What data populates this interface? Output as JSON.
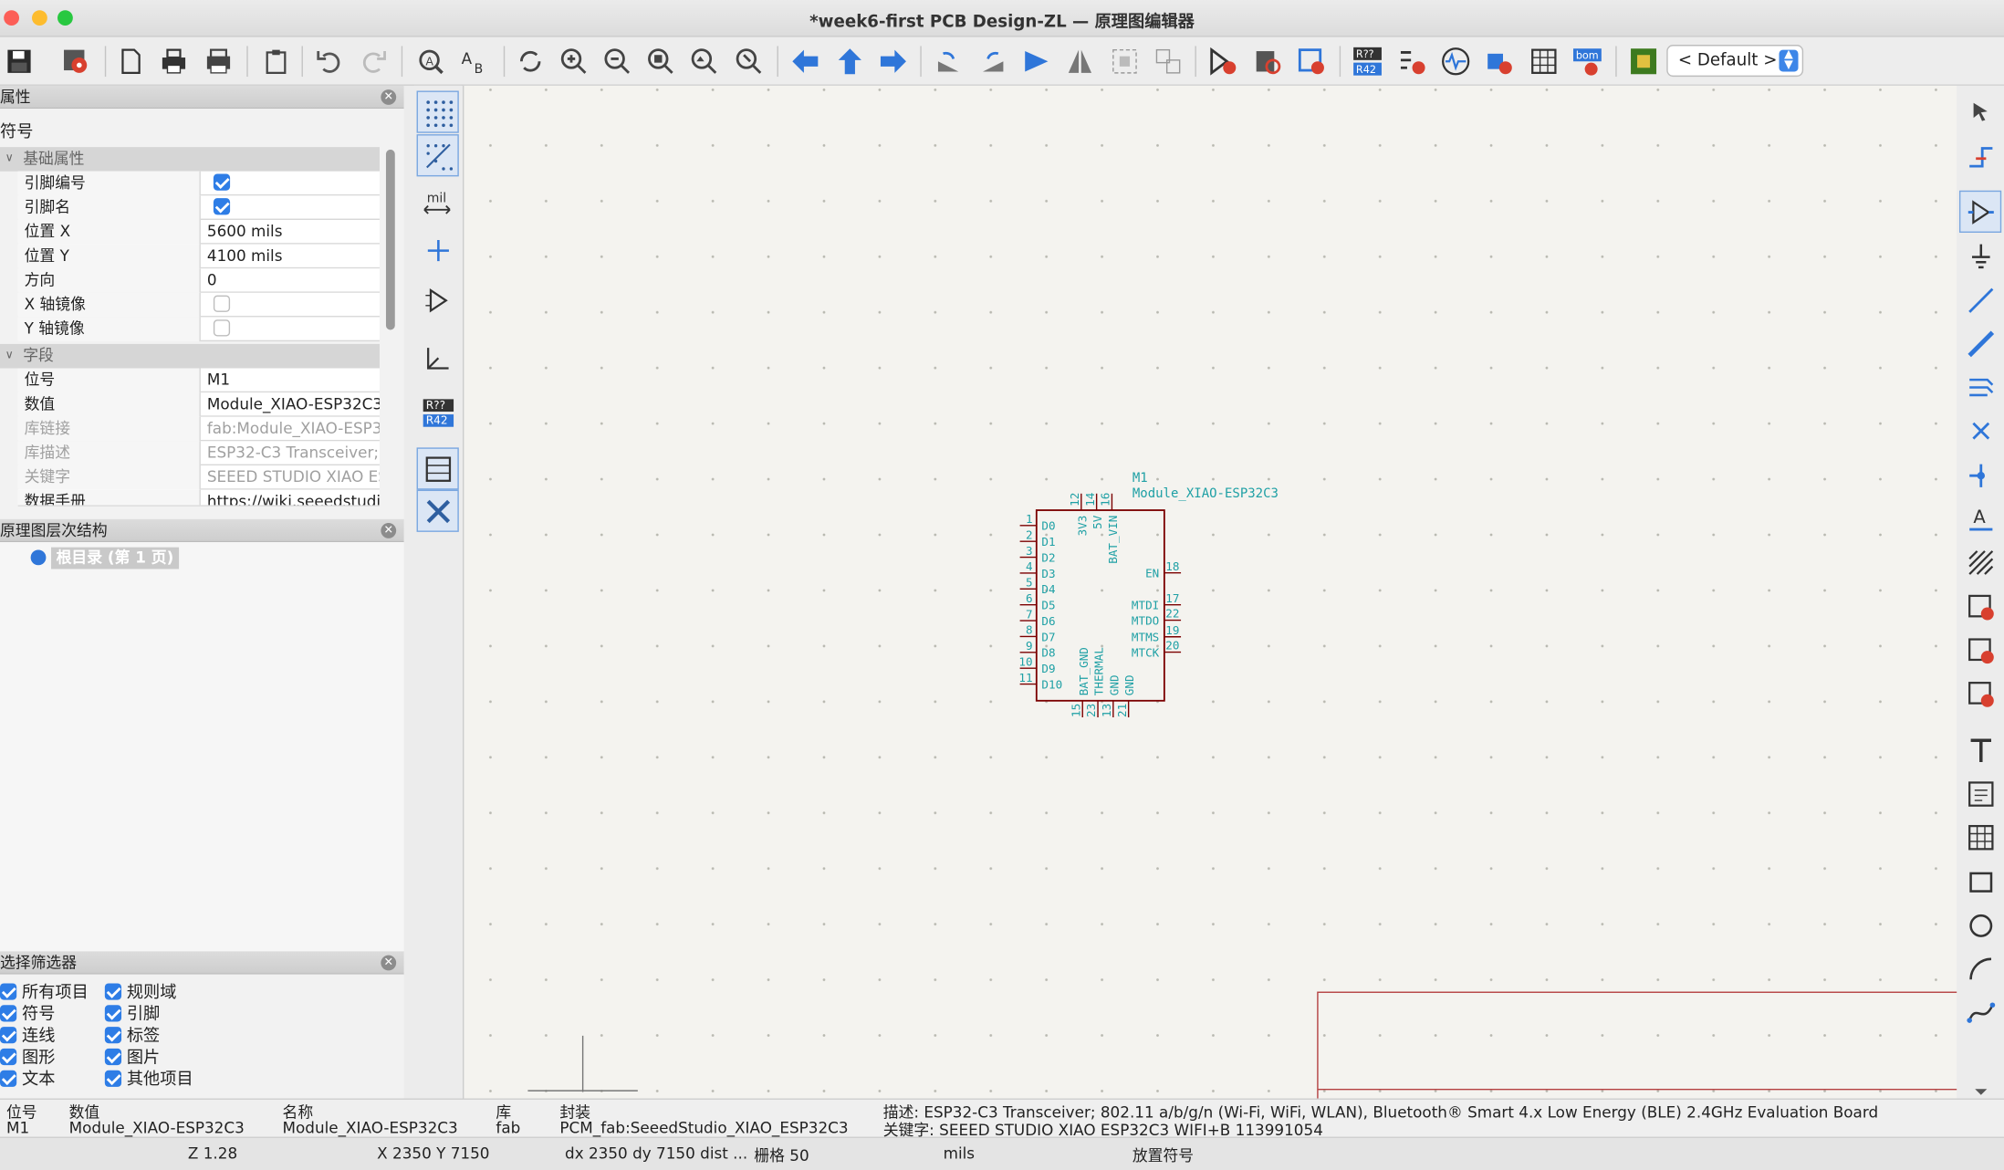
{
  "window": {
    "title": "*week6-first PCB Design-ZL — 原理图编辑器"
  },
  "toolbar": {
    "net_class_selector": "< Default >"
  },
  "properties_panel": {
    "title": "属性",
    "subtitle": "符号",
    "basic_category": "基础属性",
    "fields_category": "字段",
    "rows": [
      {
        "key": "引脚编号",
        "checked": true
      },
      {
        "key": "引脚名",
        "checked": true
      },
      {
        "key": "位置 X",
        "value": "5600 mils"
      },
      {
        "key": "位置 Y",
        "value": "4100 mils"
      },
      {
        "key": "方向",
        "value": "0"
      },
      {
        "key": "X 轴镜像",
        "checked": false
      },
      {
        "key": "Y 轴镜像",
        "checked": false
      }
    ],
    "fields": [
      {
        "key": "位号",
        "value": "M1"
      },
      {
        "key": "数值",
        "value": "Module_XIAO-ESP32C3"
      },
      {
        "key": "库链接",
        "value": "fab:Module_XIAO-ESP3"
      },
      {
        "key": "库描述",
        "value": "ESP32-C3 Transceiver;"
      },
      {
        "key": "关键字",
        "value": "SEEED STUDIO XIAO ES"
      },
      {
        "key": "数据手册",
        "value": "https://wiki.seeedstudio"
      }
    ]
  },
  "hierarchy_panel": {
    "title": "原理图层次结构",
    "root_item": "根目录 (第 1 页)"
  },
  "selection_filter": {
    "title": "选择筛选器",
    "items": [
      "所有项目",
      "规则域",
      "符号",
      "引脚",
      "连线",
      "标签",
      "图形",
      "图片",
      "文本",
      "其他项目"
    ]
  },
  "symbol": {
    "ref": "M1",
    "value": "Module_XIAO-ESP32C3",
    "left_pins": [
      {
        "num": "1",
        "name": "D0"
      },
      {
        "num": "2",
        "name": "D1"
      },
      {
        "num": "3",
        "name": "D2"
      },
      {
        "num": "4",
        "name": "D3"
      },
      {
        "num": "5",
        "name": "D4"
      },
      {
        "num": "6",
        "name": "D5"
      },
      {
        "num": "7",
        "name": "D6"
      },
      {
        "num": "8",
        "name": "D7"
      },
      {
        "num": "9",
        "name": "D8"
      },
      {
        "num": "10",
        "name": "D9"
      },
      {
        "num": "11",
        "name": "D10"
      }
    ],
    "top_pins": [
      {
        "num": "12",
        "name": "3V3"
      },
      {
        "num": "14",
        "name": "5V"
      },
      {
        "num": "16",
        "name": "BAT_VIN"
      }
    ],
    "right_pins": [
      {
        "num": "18",
        "name": "EN"
      },
      {
        "num": "17",
        "name": "MTDI"
      },
      {
        "num": "22",
        "name": "MTDO"
      },
      {
        "num": "19",
        "name": "MTMS"
      },
      {
        "num": "20",
        "name": "MTCK"
      }
    ],
    "bottom_pins": [
      {
        "num": "15",
        "name": "BAT_GND"
      },
      {
        "num": "23",
        "name": "THERMAL"
      },
      {
        "num": "13",
        "name": "GND"
      },
      {
        "num": "21",
        "name": "GND"
      }
    ]
  },
  "info_bar": {
    "ref_label": "位号",
    "ref_value": "M1",
    "value_label": "数值",
    "value_value": "Module_XIAO-ESP32C3",
    "name_label": "名称",
    "name_value": "Module_XIAO-ESP32C3",
    "lib_label": "库",
    "lib_value": "fab",
    "footprint_label": "封装",
    "footprint_value": "PCM_fab:SeeedStudio_XIAO_ESP32C3",
    "description": "描述: ESP32-C3 Transceiver; 802.11 a/b/g/n (Wi-Fi, WiFi, WLAN), Bluetooth® Smart 4.x Low Energy (BLE) 2.4GHz Evaluation Board",
    "keywords": "关键字: SEEED STUDIO XIAO ESP32C3 WIFI+B 113991054"
  },
  "status_bar": {
    "zoom": "Z 1.28",
    "coords": "X 2350  Y 7150",
    "delta": "dx 2350  dy 7150  dist ...",
    "grid": "栅格 50",
    "units": "mils",
    "mode": "放置符号"
  },
  "colors": {
    "accent": "#3d86e8",
    "symbol_text": "#1fa0a5",
    "symbol_body": "#7b0000",
    "canvas_bg": "#f4f3ef"
  }
}
